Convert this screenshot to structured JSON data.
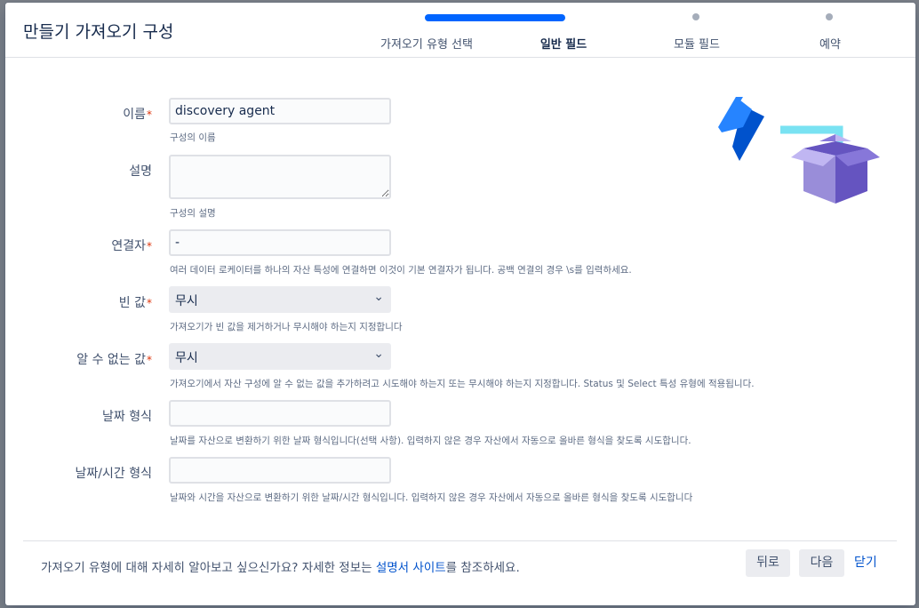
{
  "dialog": {
    "title": "만들기 가져오기 구성"
  },
  "steps": [
    {
      "label": "가져오기 유형 선택"
    },
    {
      "label": "일반 필드"
    },
    {
      "label": "모듈 필드"
    },
    {
      "label": "예약"
    }
  ],
  "form": {
    "name": {
      "label": "이름",
      "value": "discovery agent",
      "help": "구성의 이름"
    },
    "description": {
      "label": "설명",
      "value": "",
      "help": "구성의 설명"
    },
    "concatenator": {
      "label": "연결자",
      "value": "-",
      "help": "여러 데이터 로케이터를 하나의 자산 특성에 연결하면 이것이 기본 연결자가 됩니다. 공백 연결의 경우 \\s를 입력하세요."
    },
    "empty_values": {
      "label": "빈 값",
      "value": "무시",
      "help": "가져오기가 빈 값을 제거하거나 무시해야 하는지 지정합니다"
    },
    "unknown_values": {
      "label": "알 수 없는 값",
      "value": "무시",
      "help": "가져오기에서 자산 구성에 알 수 없는 값을 추가하려고 시도해야 하는지 또는 무시해야 하는지 지정합니다. Status 및 Select 특성 유형에 적용됩니다."
    },
    "date_format": {
      "label": "날짜 형식",
      "value": "",
      "help": "날짜를 자산으로 변환하기 위한 날짜 형식입니다(선택 사항). 입력하지 않은 경우 자산에서 자동으로 올바른 형식을 찾도록 시도합니다."
    },
    "datetime_format": {
      "label": "날짜/시간 형식",
      "value": "",
      "help": "날짜와 시간을 자산으로 변환하기 위한 날짜/시간 형식입니다. 입력하지 않은 경우 자산에서 자동으로 올바른 형식을 찾도록 시도합니다"
    },
    "required_mark": "*",
    "select_chevron": "⌄"
  },
  "footer": {
    "note_before": "가져오기 유형에 대해 자세히 알아보고 싶으신가요? 자세한 정보는 ",
    "note_link": "설명서 사이트",
    "note_after": "를 참조하세요.",
    "back": "뒤로",
    "next": "다음",
    "close": "닫기"
  },
  "colors": {
    "accent": "#0065ff",
    "link": "#0052cc",
    "required": "#de350b"
  },
  "icons": {
    "illustration": "import-box-illustration"
  }
}
